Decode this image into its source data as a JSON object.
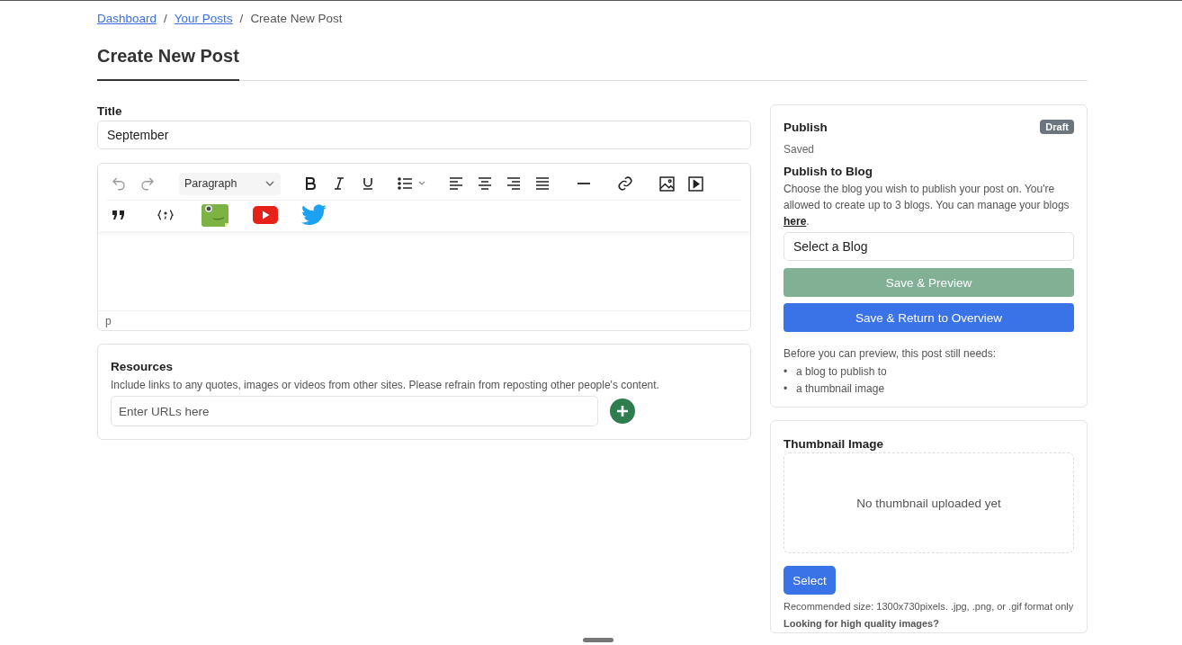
{
  "breadcrumbs": [
    {
      "label": "Dashboard",
      "kind": "link"
    },
    {
      "label": "/",
      "kind": "separator"
    },
    {
      "label": "Your Posts",
      "kind": "link"
    },
    {
      "label": "/",
      "kind": "separator"
    },
    {
      "label": "Create New Post",
      "kind": "current"
    }
  ],
  "page_title": "Create New Post",
  "title_field": {
    "label": "Title",
    "value": "September"
  },
  "editor": {
    "undo_disabled": true,
    "redo_disabled": true,
    "block_format": "Paragraph",
    "status_path": "p"
  },
  "resources": {
    "title": "Resources",
    "description": "Include links to any quotes, images or videos from other sites. Please refrain from reposting other people's content.",
    "placeholder": "Enter URLs here"
  },
  "publish": {
    "title": "Publish",
    "badge": "Draft",
    "save_state": "Saved",
    "blog_heading": "Publish to Blog",
    "blog_description": "Choose the blog you wish to publish your post on. You're allowed to create up to 3 blogs. You can manage your blogs ",
    "blog_link": "here",
    "blog_description_end": ".",
    "blog_select": {
      "placeholder": "Select a Blog"
    },
    "buttons": [
      {
        "label": "Save & Preview",
        "kind": "preview",
        "disabled": true
      },
      {
        "label": "Save & Return to Overview",
        "kind": "primary",
        "disabled": false
      }
    ],
    "requirements_intro": "Before you can preview, this post still needs:",
    "requirements": [
      {
        "bullet": "•",
        "text": "a blog to publish to"
      },
      {
        "bullet": "•",
        "text": "a thumbnail image"
      }
    ]
  },
  "thumbnail": {
    "title": "Thumbnail Image",
    "empty_text": "No thumbnail uploaded yet",
    "button": "Select",
    "hint": "Recommended size: 1300x730pixels. .jpg, .png, or .gif format only **Looking for high quality images?**"
  }
}
